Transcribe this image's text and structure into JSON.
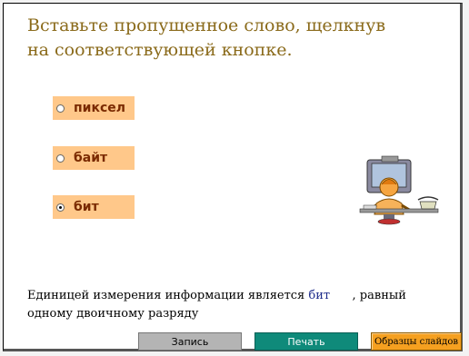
{
  "title": "Вставьте пропущенное слово, щелкнув\nна соответствующей кнопке.",
  "options": [
    {
      "label": "пиксел",
      "checked": false
    },
    {
      "label": "байт",
      "checked": false
    },
    {
      "label": "бит",
      "checked": true
    }
  ],
  "sentence": {
    "before": "Единицей измерения информации является ",
    "answer": "бит",
    "after": " , равный одному двоичному разряду"
  },
  "buttons": {
    "record": "Запись",
    "print": "Печать",
    "samples": "Образцы слайдов"
  },
  "colors": {
    "title": "#8a6a1a",
    "option_bg": "#ffc88a",
    "print_btn": "#0f8a7a",
    "samples_btn": "#f5a020",
    "answer": "#1c2a8a"
  }
}
